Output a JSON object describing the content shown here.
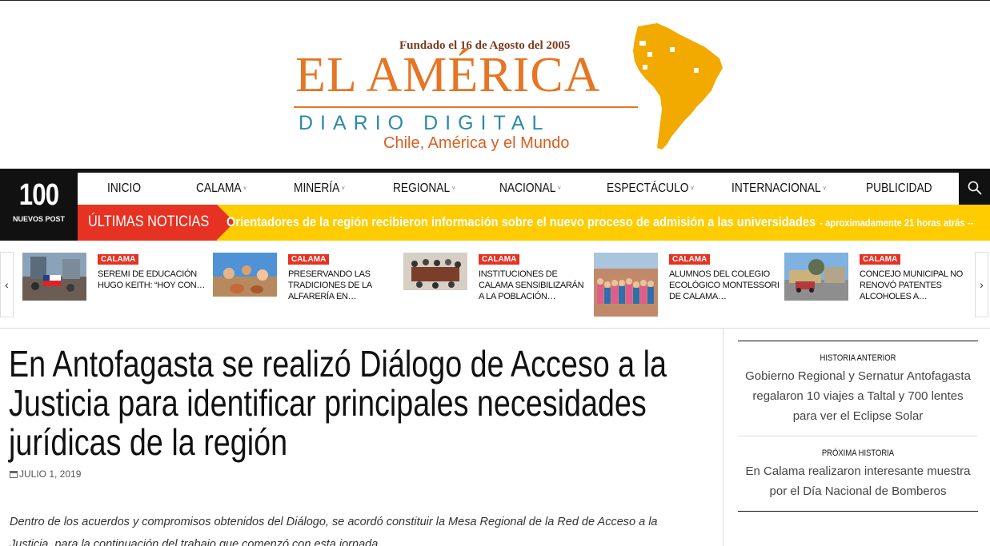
{
  "logo": {
    "founded": "Fundado el 16 de Agosto del 2005",
    "name": "EL AMÉRICA",
    "tagline": "DIARIO DIGITAL",
    "subtitle": "Chile, América y el Mundo"
  },
  "counter": {
    "number": "100",
    "label": "NUEVOS POST"
  },
  "menu": [
    {
      "label": "INICIO",
      "dropdown": false
    },
    {
      "label": "CALAMA",
      "dropdown": true
    },
    {
      "label": "MINERÍA",
      "dropdown": true
    },
    {
      "label": "REGIONAL",
      "dropdown": true
    },
    {
      "label": "NACIONAL",
      "dropdown": true
    },
    {
      "label": "ESPECTÁCULO",
      "dropdown": true
    },
    {
      "label": "INTERNACIONAL",
      "dropdown": true
    },
    {
      "label": "PUBLICIDAD",
      "dropdown": false
    }
  ],
  "ticker": {
    "label": "ÚLTIMAS NOTICIAS",
    "headline": "Orientadores de la región recibieron información sobre el nuevo proceso de admisión a las universidades",
    "time": "- aproximadamente 21 horas atrás --"
  },
  "carousel": [
    {
      "category": "CALAMA",
      "title": "SEREMI DE EDUCACIÓN HUGO KEITH: “HOY CON…"
    },
    {
      "category": "CALAMA",
      "title": "PRESERVANDO LAS TRADICIONES DE LA ALFARERÍA EN…"
    },
    {
      "category": "CALAMA",
      "title": "INSTITUCIONES DE CALAMA SENSIBILIZARÁN A LA POBLACIÓN…"
    },
    {
      "category": "CALAMA",
      "title": "ALUMNOS DEL COLEGIO ECOLÓGICO MONTESSORI DE CALAMA…"
    },
    {
      "category": "CALAMA",
      "title": "CONCEJO MUNICIPAL NO RENOVÓ PATENTES ALCOHOLES A…"
    }
  ],
  "article": {
    "title": "En Antofagasta se realizó Diálogo de Acceso a la Justicia para identificar principales necesidades jurídicas de la región",
    "date": "JULIO 1, 2019",
    "lead": "Dentro de los acuerdos y compromisos obtenidos del Diálogo, se acordó constituir la Mesa Regional de la Red de Acceso a la Justicia, para la continuación del trabajo que comenzó con esta jornada."
  },
  "sidebar": {
    "prev_label": "HISTORIA ANTERIOR",
    "prev_title": "Gobierno Regional y Sernatur Antofagasta regalaron 10 viajes a Taltal y 700 lentes para ver el Eclipse Solar",
    "next_label": "PRÓXIMA HISTORIA",
    "next_title": "En Calama realizaron interesante muestra por el Día Nacional de Bomberos"
  },
  "colors": {
    "accent_red": "#e63222",
    "ticker_yellow": "#ffcc00",
    "logo_orange": "#e67525",
    "logo_teal": "#2d8aa8"
  }
}
